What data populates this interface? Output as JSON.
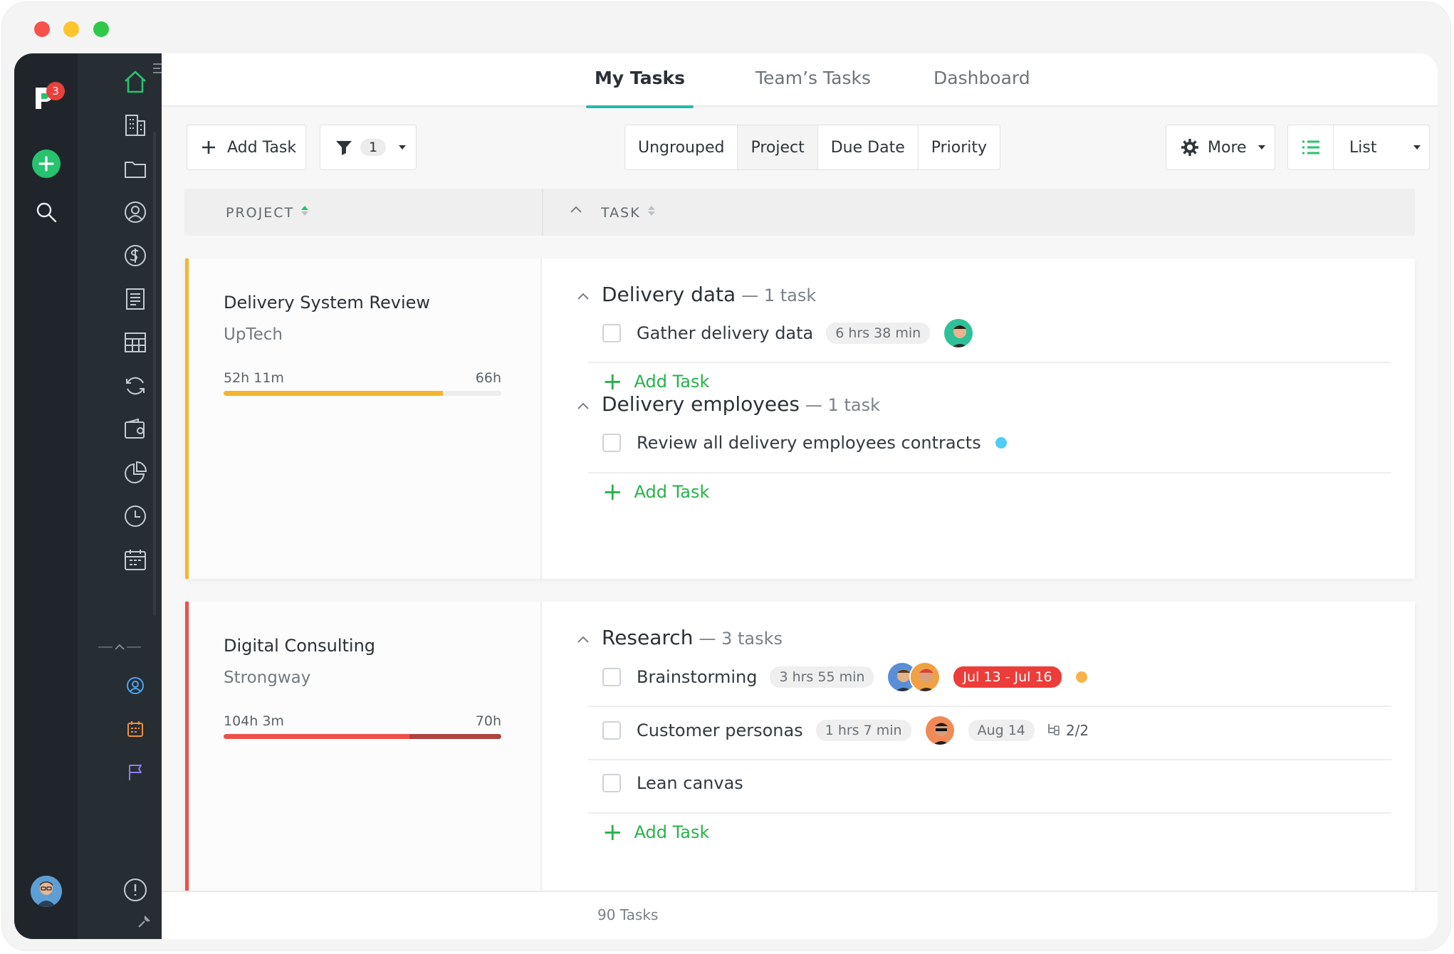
{
  "rail": {
    "notification_count": "3",
    "icons": [
      "logo-icon",
      "add-icon",
      "search-icon",
      "avatar"
    ]
  },
  "sidebar": {
    "icons": [
      "home-icon",
      "building-icon",
      "folder-icon",
      "user-circle-icon",
      "dollar-icon",
      "document-icon",
      "table-icon",
      "refresh-icon",
      "wallet-icon",
      "pie-chart-icon",
      "clock-icon",
      "calendar-icon",
      "account-icon",
      "schedule-icon",
      "flag-icon",
      "info-icon",
      "wrench-icon"
    ],
    "accent_color": "#27c36e"
  },
  "topnav": {
    "tabs": [
      {
        "label": "My Tasks",
        "active": true
      },
      {
        "label": "Team’s Tasks",
        "active": false
      },
      {
        "label": "Dashboard",
        "active": false
      }
    ]
  },
  "toolbar": {
    "add_task_label": "Add Task",
    "filter_count": "1",
    "grouping": [
      "Ungrouped",
      "Project",
      "Due Date",
      "Priority"
    ],
    "grouping_active": "Project",
    "more_label": "More",
    "view_label": "List"
  },
  "table_head": {
    "project": "PROJECT",
    "task": "TASK"
  },
  "groups": [
    {
      "project": "Delivery System Review",
      "client": "UpTech",
      "spent": "52h 11m",
      "budget": "66h",
      "progress_fraction": 0.79,
      "accent": "#f7b431",
      "tasklists": [
        {
          "title": "Delivery data",
          "count": "— 1 task",
          "tasks": [
            {
              "name": "Gather delivery data",
              "time": "6 hrs 38 min"
            }
          ],
          "add_label": "Add Task"
        },
        {
          "title": "Delivery employees",
          "count": "— 1 task",
          "tasks": [
            {
              "name": "Review all delivery employees contracts"
            }
          ],
          "add_label": "Add Task"
        }
      ]
    },
    {
      "project": "Digital Consulting",
      "client": "Strongway",
      "spent": "104h 3m",
      "budget": "70h",
      "progress_fraction": 1.49,
      "accent": "#ee4f4b",
      "tasklists": [
        {
          "title": "Research",
          "count": "— 3 tasks",
          "tasks": [
            {
              "name": "Brainstorming",
              "time": "3 hrs 55 min",
              "date": "Jul 13 - Jul 16"
            },
            {
              "name": "Customer personas",
              "time": "1 hrs 7 min",
              "date": "Aug 14",
              "subtasks": "2/2"
            },
            {
              "name": "Lean canvas"
            }
          ],
          "add_label": "Add Task"
        }
      ]
    }
  ],
  "footer": {
    "total": "90 Tasks"
  },
  "colors": {
    "brand_green": "#27c36e",
    "link_green": "#27b24a",
    "teal_underline": "#27b8a8",
    "overdue_red": "#ec3d3a",
    "blue_dot": "#4fcdf2",
    "orange_dot": "#f7b34a"
  }
}
